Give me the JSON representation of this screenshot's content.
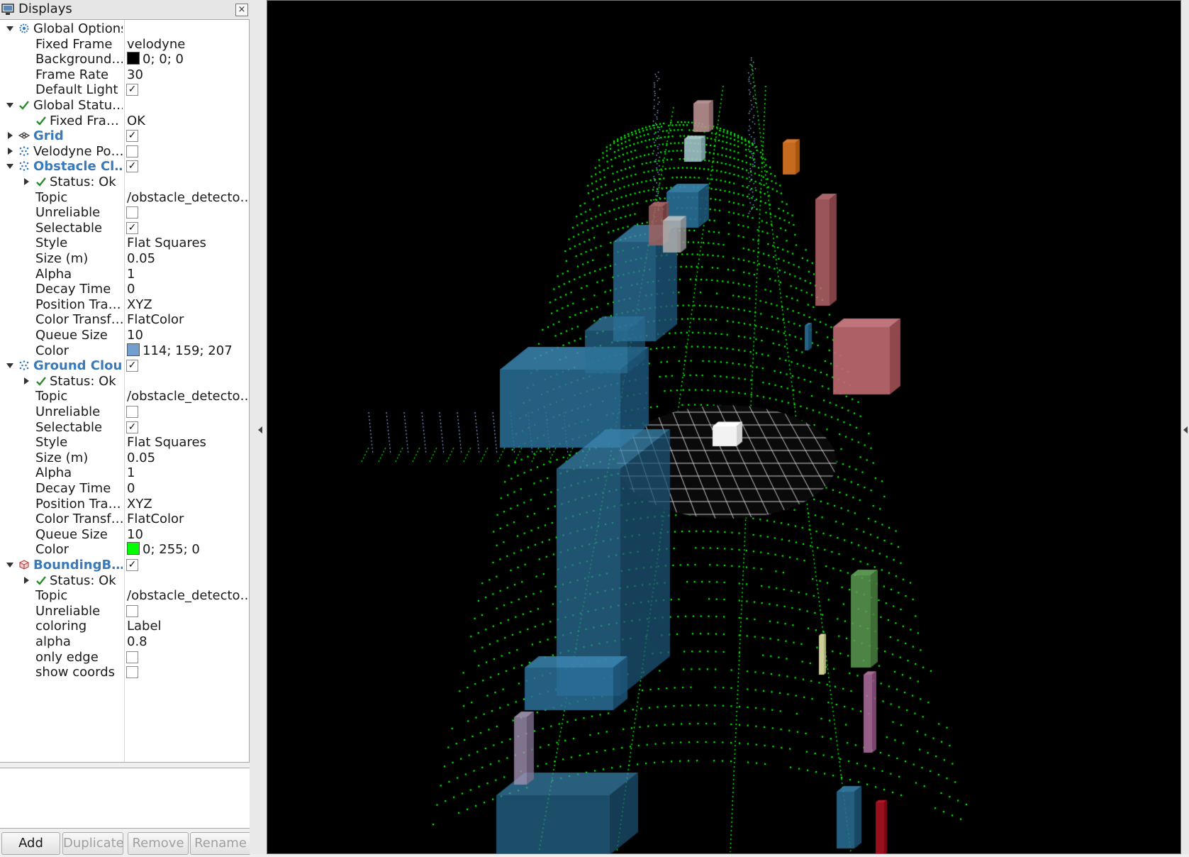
{
  "panel": {
    "title": "Displays",
    "close_glyph": "×",
    "rows": [
      {
        "name": "Global Options",
        "indent": 0,
        "expander": "down",
        "icon": "gear-icon",
        "value": "",
        "checkbox": null,
        "highlight": false
      },
      {
        "name": "Fixed Frame",
        "indent": 1,
        "expander": "",
        "icon": "",
        "value": "velodyne",
        "checkbox": null,
        "highlight": false
      },
      {
        "name": "Background…",
        "indent": 1,
        "expander": "",
        "icon": "",
        "value": "0; 0; 0",
        "swatch": "#000000",
        "checkbox": null,
        "highlight": false
      },
      {
        "name": "Frame Rate",
        "indent": 1,
        "expander": "",
        "icon": "",
        "value": "30",
        "checkbox": null,
        "highlight": false
      },
      {
        "name": "Default Light",
        "indent": 1,
        "expander": "",
        "icon": "",
        "value": "",
        "checkbox": true,
        "highlight": false
      },
      {
        "name": "Global Statu…",
        "indent": 0,
        "expander": "down",
        "icon": "check-icon",
        "value": "",
        "checkbox": null,
        "highlight": false
      },
      {
        "name": "Fixed Fra…",
        "indent": 1,
        "expander": "",
        "icon": "check-icon",
        "value": "OK",
        "checkbox": null,
        "highlight": false
      },
      {
        "name": "Grid",
        "indent": 0,
        "expander": "right",
        "icon": "grid-icon",
        "value": "",
        "checkbox": true,
        "highlight": true
      },
      {
        "name": "Velodyne Po…",
        "indent": 0,
        "expander": "right",
        "icon": "pointcloud-icon",
        "value": "",
        "checkbox": false,
        "highlight": false
      },
      {
        "name": "Obstacle Cl…",
        "indent": 0,
        "expander": "down",
        "icon": "pointcloud-icon",
        "value": "",
        "checkbox": true,
        "highlight": true
      },
      {
        "name": "Status: Ok",
        "indent": 1,
        "expander": "right",
        "icon": "check-icon",
        "value": "",
        "checkbox": null,
        "highlight": false
      },
      {
        "name": "Topic",
        "indent": 1,
        "expander": "",
        "icon": "",
        "value": "/obstacle_detecto…",
        "checkbox": null,
        "highlight": false
      },
      {
        "name": "Unreliable",
        "indent": 1,
        "expander": "",
        "icon": "",
        "value": "",
        "checkbox": false,
        "highlight": false
      },
      {
        "name": "Selectable",
        "indent": 1,
        "expander": "",
        "icon": "",
        "value": "",
        "checkbox": true,
        "highlight": false
      },
      {
        "name": "Style",
        "indent": 1,
        "expander": "",
        "icon": "",
        "value": "Flat Squares",
        "checkbox": null,
        "highlight": false
      },
      {
        "name": "Size (m)",
        "indent": 1,
        "expander": "",
        "icon": "",
        "value": "0.05",
        "checkbox": null,
        "highlight": false
      },
      {
        "name": "Alpha",
        "indent": 1,
        "expander": "",
        "icon": "",
        "value": "1",
        "checkbox": null,
        "highlight": false
      },
      {
        "name": "Decay Time",
        "indent": 1,
        "expander": "",
        "icon": "",
        "value": "0",
        "checkbox": null,
        "highlight": false
      },
      {
        "name": "Position Tra…",
        "indent": 1,
        "expander": "",
        "icon": "",
        "value": "XYZ",
        "checkbox": null,
        "highlight": false
      },
      {
        "name": "Color Transf…",
        "indent": 1,
        "expander": "",
        "icon": "",
        "value": "FlatColor",
        "checkbox": null,
        "highlight": false
      },
      {
        "name": "Queue Size",
        "indent": 1,
        "expander": "",
        "icon": "",
        "value": "10",
        "checkbox": null,
        "highlight": false
      },
      {
        "name": "Color",
        "indent": 1,
        "expander": "",
        "icon": "",
        "value": "114; 159; 207",
        "swatch": "#729fcf",
        "checkbox": null,
        "highlight": false
      },
      {
        "name": "Ground Cloud",
        "indent": 0,
        "expander": "down",
        "icon": "pointcloud-icon",
        "value": "",
        "checkbox": true,
        "highlight": true
      },
      {
        "name": "Status: Ok",
        "indent": 1,
        "expander": "right",
        "icon": "check-icon",
        "value": "",
        "checkbox": null,
        "highlight": false
      },
      {
        "name": "Topic",
        "indent": 1,
        "expander": "",
        "icon": "",
        "value": "/obstacle_detecto…",
        "checkbox": null,
        "highlight": false
      },
      {
        "name": "Unreliable",
        "indent": 1,
        "expander": "",
        "icon": "",
        "value": "",
        "checkbox": false,
        "highlight": false
      },
      {
        "name": "Selectable",
        "indent": 1,
        "expander": "",
        "icon": "",
        "value": "",
        "checkbox": true,
        "highlight": false
      },
      {
        "name": "Style",
        "indent": 1,
        "expander": "",
        "icon": "",
        "value": "Flat Squares",
        "checkbox": null,
        "highlight": false
      },
      {
        "name": "Size (m)",
        "indent": 1,
        "expander": "",
        "icon": "",
        "value": "0.05",
        "checkbox": null,
        "highlight": false
      },
      {
        "name": "Alpha",
        "indent": 1,
        "expander": "",
        "icon": "",
        "value": "1",
        "checkbox": null,
        "highlight": false
      },
      {
        "name": "Decay Time",
        "indent": 1,
        "expander": "",
        "icon": "",
        "value": "0",
        "checkbox": null,
        "highlight": false
      },
      {
        "name": "Position Tra…",
        "indent": 1,
        "expander": "",
        "icon": "",
        "value": "XYZ",
        "checkbox": null,
        "highlight": false
      },
      {
        "name": "Color Transf…",
        "indent": 1,
        "expander": "",
        "icon": "",
        "value": "FlatColor",
        "checkbox": null,
        "highlight": false
      },
      {
        "name": "Queue Size",
        "indent": 1,
        "expander": "",
        "icon": "",
        "value": "10",
        "checkbox": null,
        "highlight": false
      },
      {
        "name": "Color",
        "indent": 1,
        "expander": "",
        "icon": "",
        "value": "0; 255; 0",
        "swatch": "#00ff00",
        "checkbox": null,
        "highlight": false
      },
      {
        "name": "BoundingB…",
        "indent": 0,
        "expander": "down",
        "icon": "box-icon",
        "value": "",
        "checkbox": true,
        "highlight": true
      },
      {
        "name": "Status: Ok",
        "indent": 1,
        "expander": "right",
        "icon": "check-icon",
        "value": "",
        "checkbox": null,
        "highlight": false
      },
      {
        "name": "Topic",
        "indent": 1,
        "expander": "",
        "icon": "",
        "value": "/obstacle_detecto…",
        "checkbox": null,
        "highlight": false
      },
      {
        "name": "Unreliable",
        "indent": 1,
        "expander": "",
        "icon": "",
        "value": "",
        "checkbox": false,
        "highlight": false
      },
      {
        "name": "coloring",
        "indent": 1,
        "expander": "",
        "icon": "",
        "value": "Label",
        "checkbox": null,
        "highlight": false
      },
      {
        "name": "alpha",
        "indent": 1,
        "expander": "",
        "icon": "",
        "value": "0.8",
        "checkbox": null,
        "highlight": false
      },
      {
        "name": "only edge",
        "indent": 1,
        "expander": "",
        "icon": "",
        "value": "",
        "checkbox": false,
        "highlight": false
      },
      {
        "name": "show coords",
        "indent": 1,
        "expander": "",
        "icon": "",
        "value": "",
        "checkbox": false,
        "highlight": false
      }
    ],
    "buttons": [
      {
        "label": "Add",
        "enabled": true
      },
      {
        "label": "Duplicate",
        "enabled": false
      },
      {
        "label": "Remove",
        "enabled": false
      },
      {
        "label": "Rename",
        "enabled": false
      }
    ]
  },
  "viewport": {
    "background": "#000000",
    "ground_color": "#00ff00",
    "obstacle_color": "#729fcf"
  }
}
